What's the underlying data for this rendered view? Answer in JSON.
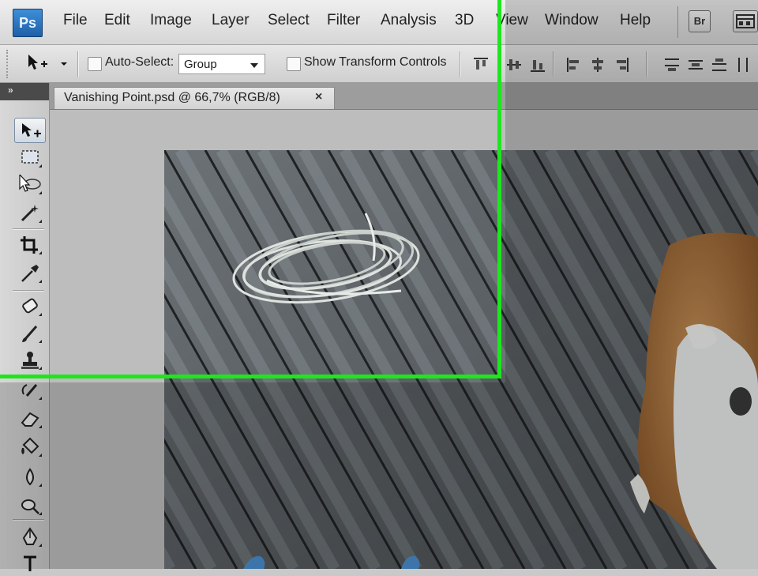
{
  "app": {
    "logo_text": "Ps"
  },
  "menu": {
    "items": [
      {
        "label": "File"
      },
      {
        "label": "Edit"
      },
      {
        "label": "Image"
      },
      {
        "label": "Layer"
      },
      {
        "label": "Select"
      },
      {
        "label": "Filter"
      },
      {
        "label": "Analysis"
      },
      {
        "label": "3D"
      },
      {
        "label": "View"
      },
      {
        "label": "Window"
      },
      {
        "label": "Help"
      }
    ],
    "bridge_label": "Br"
  },
  "options": {
    "auto_select_label": "Auto-Select:",
    "auto_select_checked": false,
    "auto_select_value": "Group",
    "show_transform_label": "Show Transform Controls",
    "show_transform_checked": false
  },
  "document": {
    "tab_title": "Vanishing Point.psd @ 66,7% (RGB/8)",
    "close_glyph": "×"
  },
  "toolbox": {
    "collapse_glyph": "»",
    "tools": [
      "move-tool",
      "marquee-tool",
      "lasso-tool",
      "magic-wand-tool",
      "crop-tool",
      "eyedropper-tool",
      "spot-healing-tool",
      "brush-tool",
      "clone-stamp-tool",
      "history-brush-tool",
      "eraser-tool",
      "paint-bucket-tool",
      "blur-tool",
      "dodge-tool",
      "pen-tool",
      "type-tool"
    ],
    "selected_tool": "move-tool"
  },
  "colors": {
    "highlight_rect": "#1ee61e",
    "deck": "#5f6468",
    "dog_fur": "#b9814a"
  }
}
